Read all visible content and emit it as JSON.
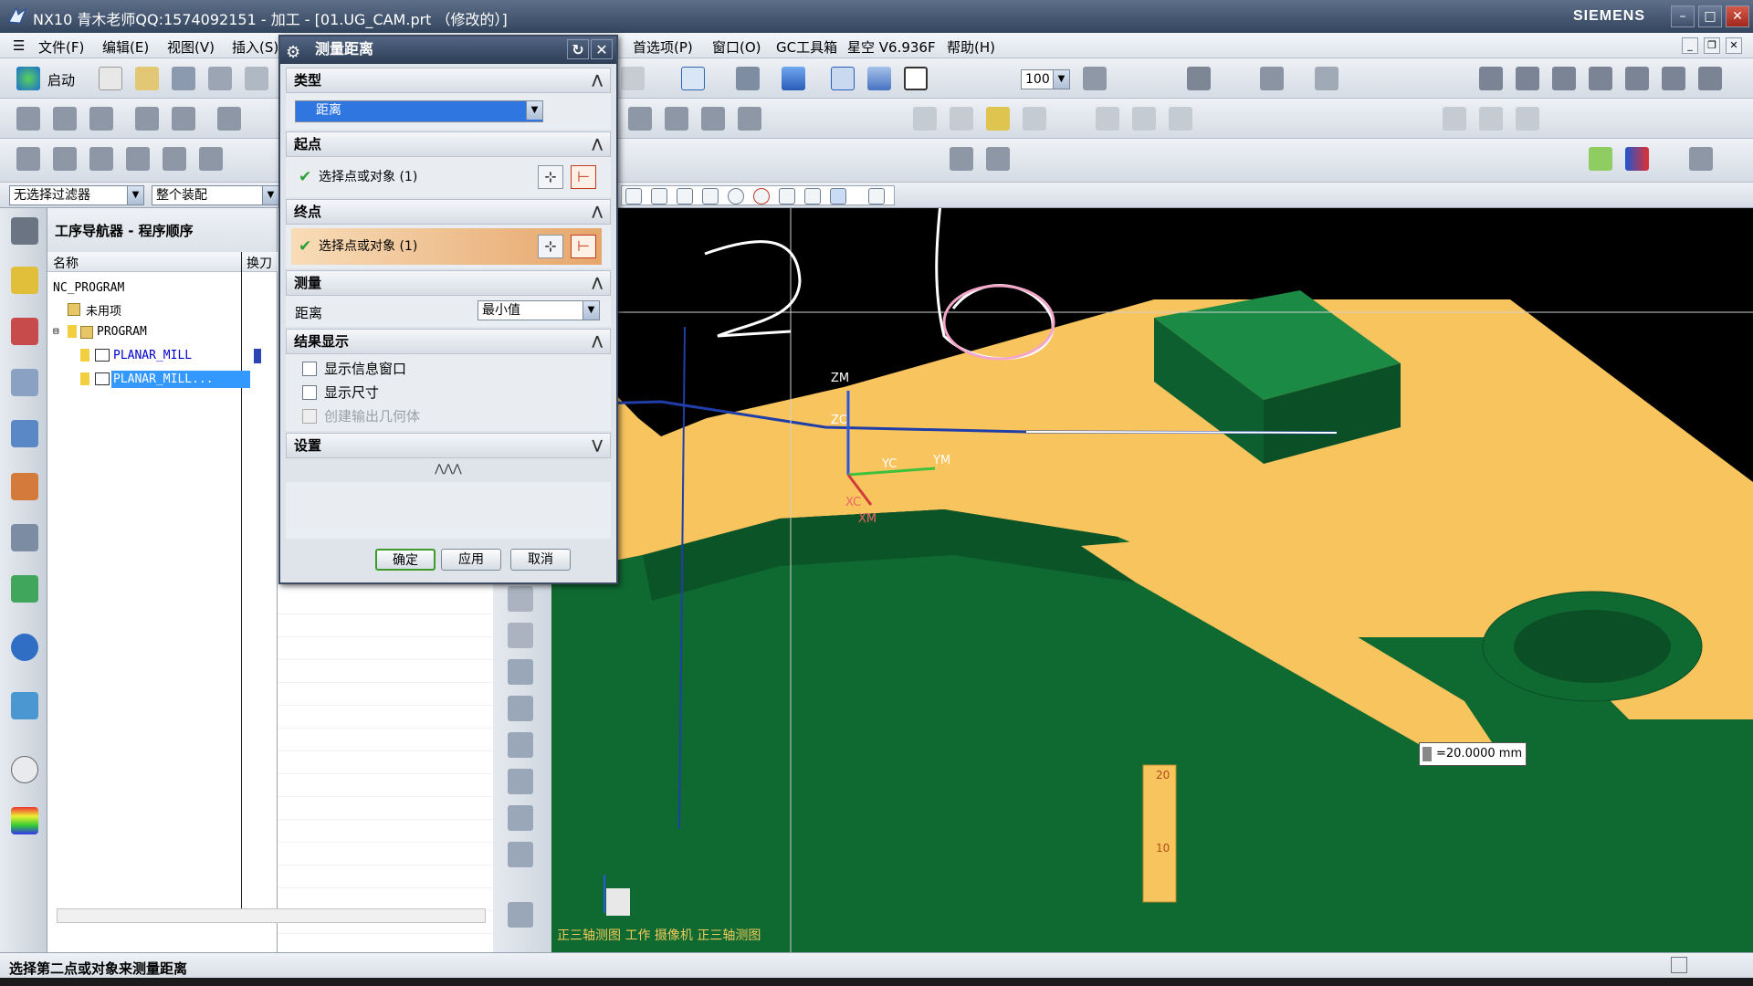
{
  "window": {
    "title": "NX10 青木老师QQ:1574092151 - 加工 - [01.UG_CAM.prt （修改的）]",
    "brand": "SIEMENS"
  },
  "menu": [
    "文件(F)",
    "编辑(E)",
    "视图(V)",
    "插入(S)",
    "首选项(P)",
    "窗口(O)",
    "GC工具箱",
    "星空 V6.936F",
    "帮助(H)"
  ],
  "toolbar": {
    "start_label": "启动",
    "zoom_value": "100"
  },
  "filterbar": {
    "filter": "无选择过滤器",
    "scope": "整个装配"
  },
  "navigator": {
    "title": "工序导航器 - 程序顺序",
    "col_name": "名称",
    "col_tool": "换刀",
    "nodes": [
      "NC_PROGRAM",
      "未用项",
      "PROGRAM",
      "PLANAR_MILL",
      "PLANAR_MILL..."
    ]
  },
  "dialog": {
    "title": "测量距离",
    "type_section": "类型",
    "type_value": "距离",
    "start_section": "起点",
    "start_select": "选择点或对象 (1)",
    "end_section": "终点",
    "end_select": "选择点或对象 (1)",
    "measure_section": "测量",
    "distance_label": "距离",
    "distance_value": "最小值",
    "result_section": "结果显示",
    "cb_info": "显示信息窗口",
    "cb_dim": "显示尺寸",
    "cb_geom": "创建输出几何体",
    "settings_section": "设置",
    "ok": "确定",
    "apply": "应用",
    "cancel": "取消"
  },
  "viewport": {
    "view_label": "正三轴测图 工作 摄像机 正三轴测图",
    "dimension": "=20.0000 mm",
    "axes": [
      "ZM",
      "ZC",
      "YC",
      "YM",
      "XC",
      "XM"
    ],
    "scale_ticks": [
      "20",
      "10"
    ]
  },
  "status": "选择第二点或对象来测量距离",
  "colors": {
    "part_top": "#f7c45e",
    "part_side": "#0f6a32",
    "titlebar": "#3c4d66"
  }
}
